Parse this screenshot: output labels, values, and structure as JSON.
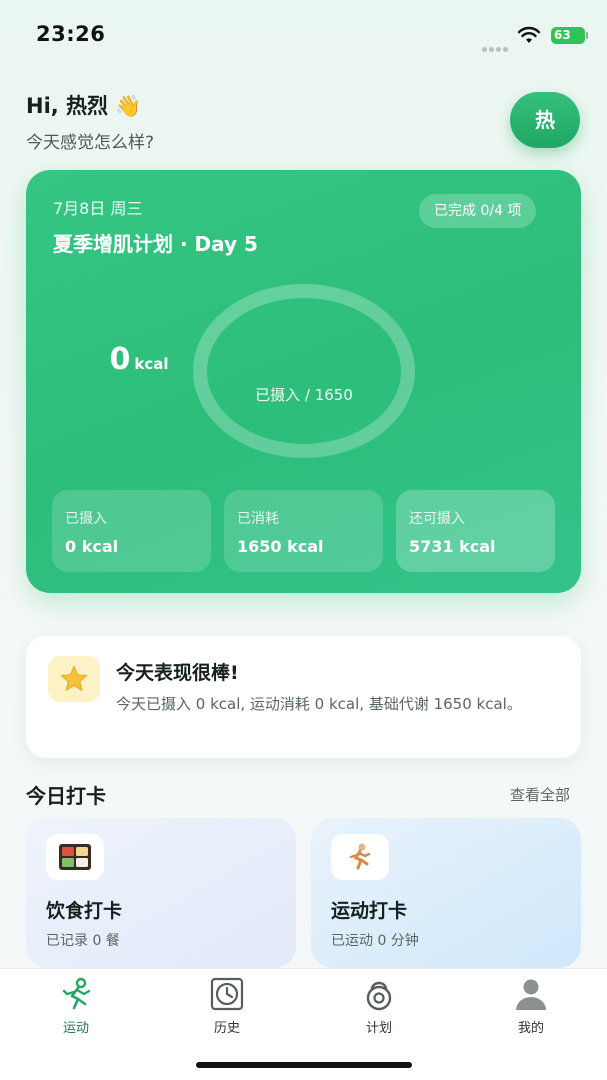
{
  "status_bar": {
    "time": "23:26",
    "battery": "63"
  },
  "header": {
    "greeting": "Hi, 热烈 👋",
    "subtitle": "今天感觉怎么样?",
    "avatar_text": "热"
  },
  "hero": {
    "date": "7月8日 周三",
    "completed": "已完成 0/4 项",
    "plan": "夏季增肌计划 · Day 5",
    "ring_value": "0",
    "ring_unit": "kcal",
    "ring_caption": "已摄入 / 1650",
    "intake_progress": 0,
    "stats": [
      {
        "label": "已摄入",
        "value": "0 kcal"
      },
      {
        "label": "已消耗",
        "value": "1650 kcal"
      },
      {
        "label": "还可摄入",
        "value": "5731 kcal"
      }
    ]
  },
  "praise": {
    "title": "今天表现很棒!",
    "text": "今天已摄入 0 kcal, 运动消耗 0 kcal, 基础代谢 1650 kcal。",
    "icon": "star-icon"
  },
  "checkin": {
    "section_title": "今日打卡",
    "view_all": "查看全部",
    "diet": {
      "title": "饮食打卡",
      "subtitle": "已记录 0 餐",
      "icon": "bento-icon"
    },
    "sport": {
      "title": "运动打卡",
      "subtitle": "已运动 0 分钟",
      "icon": "runner-icon"
    }
  },
  "tabs": [
    {
      "label": "运动",
      "icon": "running-icon",
      "active": true
    },
    {
      "label": "历史",
      "icon": "clock-icon",
      "active": false
    },
    {
      "label": "计划",
      "icon": "kettlebell-icon",
      "active": false
    },
    {
      "label": "我的",
      "icon": "person-icon",
      "active": false
    }
  ],
  "colors": {
    "accent": "#2ebe7b",
    "active_tab": "#1a7a4c"
  }
}
